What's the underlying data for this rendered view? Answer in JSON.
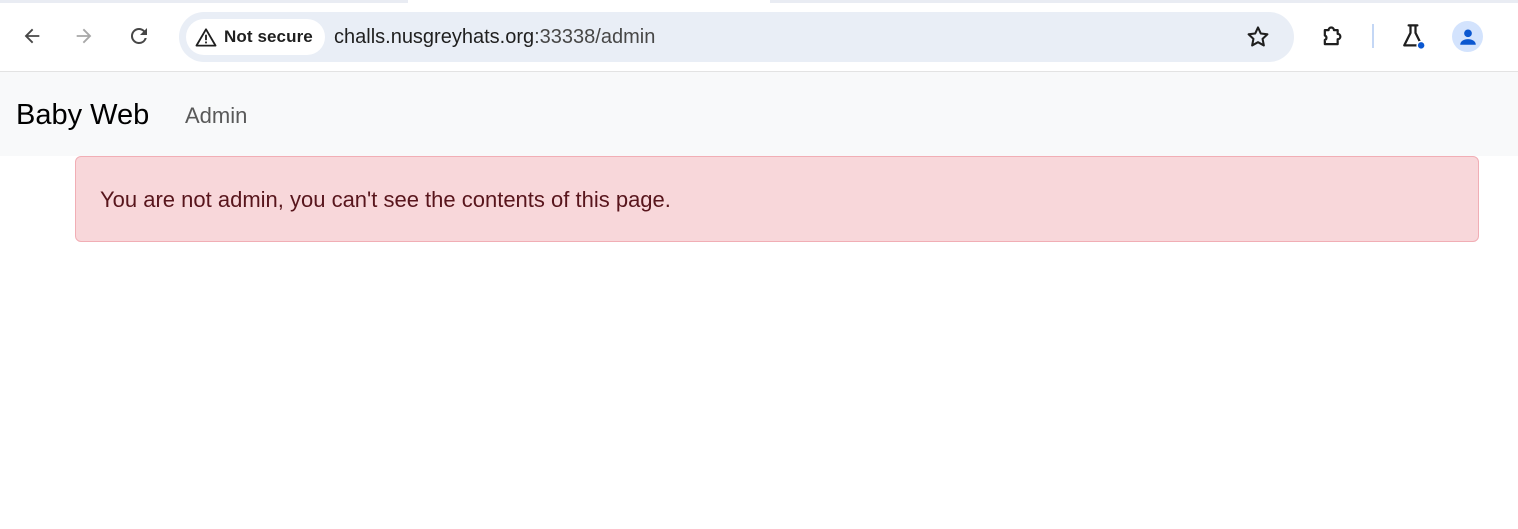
{
  "browser": {
    "security_label": "Not secure",
    "url_host": "challs.nusgreyhats.org",
    "url_rest": ":33338/admin",
    "icons": {
      "back": "arrow-left-icon",
      "forward": "arrow-right-icon",
      "reload": "reload-icon",
      "security": "warning-triangle-icon",
      "bookmark": "star-icon",
      "extensions": "puzzle-piece-icon",
      "labs": "flask-icon",
      "profile": "person-icon"
    }
  },
  "page": {
    "brand": "Baby Web",
    "nav": [
      {
        "label": "Admin"
      }
    ],
    "alert": {
      "message": "You are not admin, you can't see the contents of this page.",
      "background": "#f8d7da",
      "text_color": "#58151c"
    }
  }
}
